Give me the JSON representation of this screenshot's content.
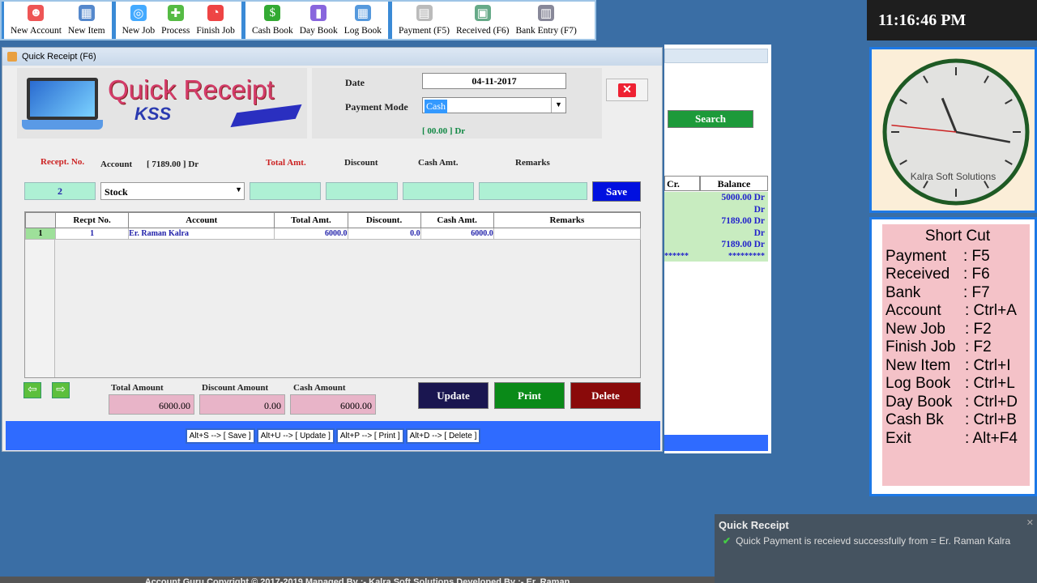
{
  "toolbar": {
    "groups": [
      [
        {
          "label": "New Account",
          "icon": "users-icon"
        },
        {
          "label": "New Item",
          "icon": "cart-icon"
        }
      ],
      [
        {
          "label": "New Job",
          "icon": "target-icon"
        },
        {
          "label": "Process",
          "icon": "puzzle-icon"
        },
        {
          "label": "Finish Job",
          "icon": "pie-icon"
        }
      ],
      [
        {
          "label": "Cash Book",
          "icon": "dollar-icon"
        },
        {
          "label": "Day Book",
          "icon": "book-icon"
        },
        {
          "label": "Log Book",
          "icon": "calendar-icon"
        }
      ],
      [
        {
          "label": "Payment (F5)",
          "icon": "document-icon"
        },
        {
          "label": "Received (F6)",
          "icon": "money-icon"
        },
        {
          "label": "Bank Entry (F7)",
          "icon": "atm-icon"
        }
      ]
    ]
  },
  "clock_time": "11:16:46 PM",
  "window": {
    "title": "Quick Receipt (F6)",
    "logo": {
      "title": "Quick Receipt",
      "brand": "KSS"
    },
    "date_label": "Date",
    "date_value": "04-11-2017",
    "payment_mode_label": "Payment Mode",
    "payment_mode_value": "Cash",
    "mode_balance": "[ 00.00 ]  Dr",
    "form": {
      "recpt_label": "Recept. No.",
      "account_label": "Account",
      "account_balance": "[ 7189.00 ]  Dr",
      "total_label": "Total Amt.",
      "discount_label": "Discount",
      "cash_label": "Cash Amt.",
      "remarks_label": "Remarks",
      "recpt_value": "2",
      "account_value": "Stock",
      "save": "Save"
    },
    "grid": {
      "headers": [
        "Recpt No.",
        "Account",
        "Total Amt.",
        "Discount.",
        "Cash Amt.",
        "Remarks"
      ],
      "rows": [
        {
          "index": "1",
          "recpt": "1",
          "account": "Er. Raman Kalra",
          "total": "6000.0",
          "discount": "0.0",
          "cash": "6000.0",
          "remarks": ""
        }
      ]
    },
    "totals": {
      "total_label": "Total Amount",
      "total_value": "6000.00",
      "discount_label": "Discount Amount",
      "discount_value": "0.00",
      "cash_label": "Cash Amount",
      "cash_value": "6000.00"
    },
    "buttons": {
      "update": "Update",
      "print": "Print",
      "delete": "Delete"
    },
    "shortcuts": [
      "Alt+S --> [ Save ]",
      "Alt+U --> [ Update ]",
      "Alt+P --> [ Print ]",
      "Alt+D --> [ Delete ]"
    ]
  },
  "background_panel": {
    "search": "Search",
    "cr_header": "Cr.",
    "balance_header": "Balance",
    "balances": [
      "5000.00  Dr",
      "Dr",
      "7189.00  Dr",
      "Dr",
      "7189.00  Dr"
    ],
    "stars_left": "******",
    "stars_right": "*********"
  },
  "clock": {
    "caption": "Kalra Soft Solutions",
    "hour": 11,
    "minute": 16,
    "second": 46
  },
  "shortcut_panel": {
    "title": "Short Cut",
    "items": [
      [
        "Payment",
        ": F5"
      ],
      [
        "Received",
        ": F6"
      ],
      [
        "Bank",
        ": F7"
      ],
      [
        "Account",
        ": Ctrl+A"
      ],
      [
        "New Job",
        ": F2"
      ],
      [
        "Finish Job",
        ": F2"
      ],
      [
        "New Item",
        ": Ctrl+I"
      ],
      [
        "Log Book",
        ": Ctrl+L"
      ],
      [
        "Day Book",
        ": Ctrl+D"
      ],
      [
        "Cash Bk",
        ": Ctrl+B"
      ],
      [
        "Exit",
        ": Alt+F4"
      ]
    ]
  },
  "toast": {
    "title": "Quick Receipt",
    "message": "Quick Payment is receievd successfully from  = Er. Raman Kalra"
  },
  "footer": "Account Guru Copyright © 2017-2019 Managed By :- Kalra Soft Solutions Developed By :- Er. Raman"
}
